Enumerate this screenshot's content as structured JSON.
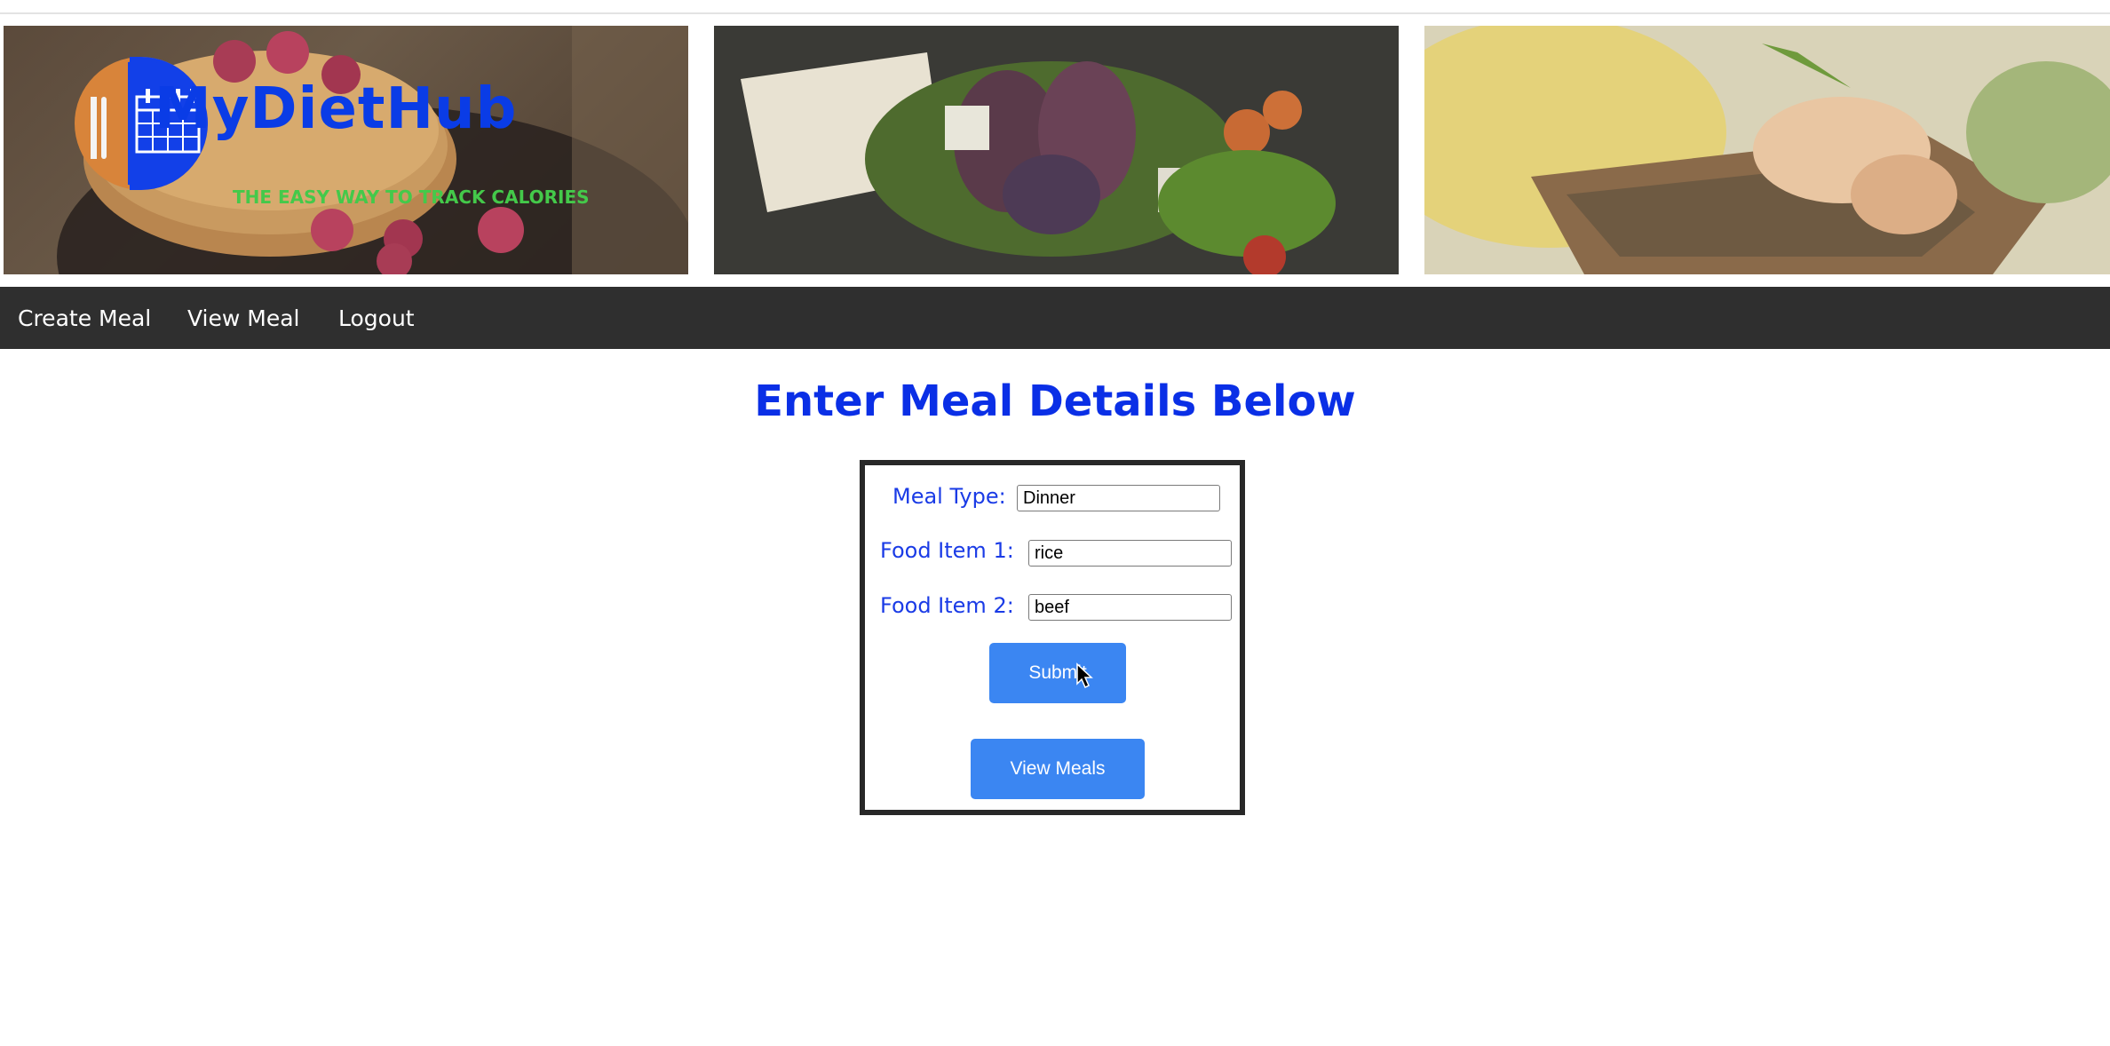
{
  "header": {
    "logo_title": "MyDietHub",
    "logo_tagline": "THE EASY WAY TO TRACK CALORIES"
  },
  "nav": {
    "items": [
      {
        "label": "Create Meal"
      },
      {
        "label": "View Meal"
      },
      {
        "label": "Logout"
      }
    ]
  },
  "main": {
    "title": "Enter Meal Details Below",
    "form": {
      "meal_type_label": "Meal Type:",
      "meal_type_value": "Dinner",
      "food1_label": "Food Item 1:",
      "food1_value": "rice",
      "food2_label": "Food Item 2:",
      "food2_value": "beef",
      "submit_label": "Submit",
      "view_meals_label": "View Meals"
    }
  },
  "colors": {
    "nav_bg": "#2f2f2f",
    "title_blue": "#0a2fe6",
    "button_blue": "#3b86f2",
    "tagline_green": "#44c94a"
  }
}
